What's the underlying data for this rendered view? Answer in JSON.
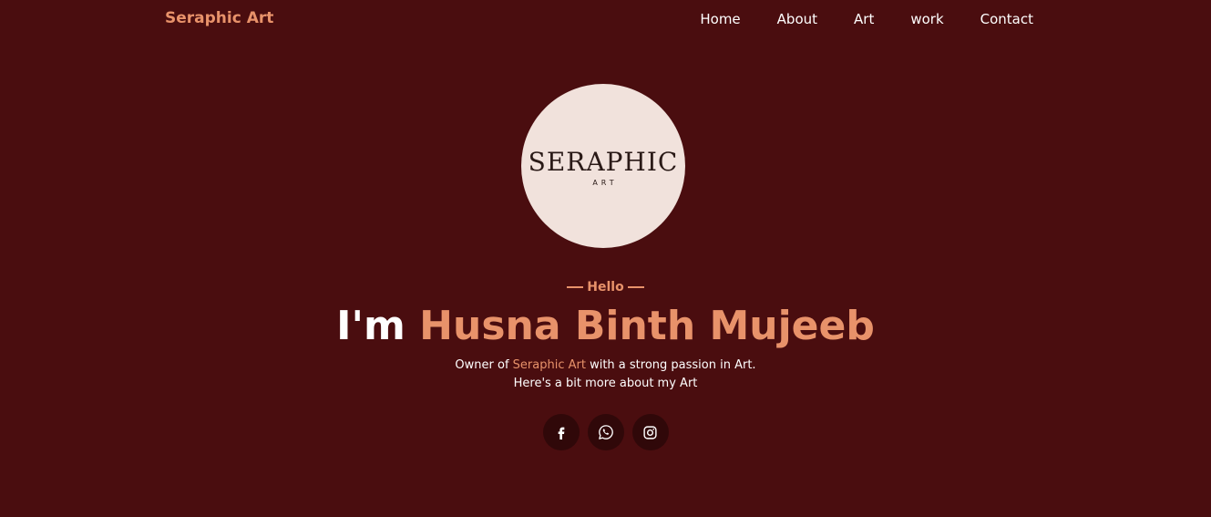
{
  "header": {
    "brand": "Seraphic Art",
    "nav": [
      {
        "label": "Home"
      },
      {
        "label": "About"
      },
      {
        "label": "Art"
      },
      {
        "label": "work"
      },
      {
        "label": "Contact"
      }
    ]
  },
  "hero": {
    "logo": {
      "word": "SERAPHIC",
      "sub": "ART"
    },
    "greeting": "Hello",
    "headline_prefix": "I'm",
    "headline_name": "Husna Binth Mujeeb",
    "desc_before": "Owner of",
    "desc_highlight": "Seraphic Art",
    "desc_after": "with a strong passion in Art.",
    "desc_line2": "Here's a bit more about my Art",
    "socials": [
      {
        "icon": "facebook-icon"
      },
      {
        "icon": "whatsapp-icon"
      },
      {
        "icon": "instagram-icon"
      }
    ]
  },
  "colors": {
    "background": "#4a0d0f",
    "accent": "#e8926a",
    "logo_circle": "#f1e2dc",
    "social_bg": "#300809",
    "text": "#ffffff"
  }
}
